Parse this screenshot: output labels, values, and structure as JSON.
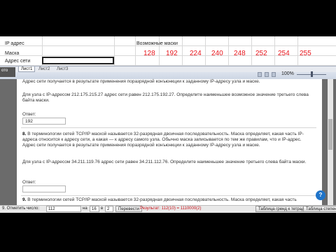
{
  "spreadsheet": {
    "row_labels": [
      "IP адрес",
      "Маска",
      "Адрес сети"
    ],
    "header": "Возможные маски",
    "masks": [
      "128",
      "192",
      "224",
      "240",
      "248",
      "252",
      "254",
      "255"
    ],
    "sheet_tabs": [
      "Лист1",
      "Лист2",
      "Лист3"
    ],
    "left_label": "ото",
    "zoom": "100%"
  },
  "page": {
    "fragment_top": "Адрес сети получается в результате применения поразрядной конъюнкции к заданному IP-адресу узла и маске.",
    "q7_text": "Для узла с IP-адресом 212.175.215.27 адрес сети равен 212.175.192.27. Определите наименьшее возможное значение третьего слева байта маски.",
    "answer_label": "Ответ:",
    "q7_answer": "192",
    "q8_number": "8.",
    "q8_text": "В терминологии сетей TCP/IP маской называется 32-разрядная двоичная последовательность. Маска определяет, какая часть IP-адреса относится к адресу сети, а какая — к адресу самого узла. Обычно маска записывается по тем же правилам, что и IP-адрес. Адрес сети получается в результате применения поразрядной конъюнкции к заданному IP-адресу узла и маске.",
    "q8_prompt": "Для узла с IP-адресом 34.211.119.76 адрес сети равен 34.211.112.76. Определите наименьшее значение третьего слева байта маски.",
    "q9_number": "9.",
    "q9_text": "В терминологии сетей TCP/IP маской называется 32-разрядная двоичная последовательность. Маска определяет, какая часть",
    "help": "?"
  },
  "find_bar": {
    "label": "9. Отметить число:",
    "value": "112",
    "in_label": "на",
    "in_value": "16",
    "base_label": "в",
    "base_value": "2",
    "button": "Перевести",
    "result": "Результат: 112(10) = 1110000(2)",
    "taskbar_1": "Таблица гренд к тетрад",
    "taskbar_2": "Таблица степеней"
  }
}
